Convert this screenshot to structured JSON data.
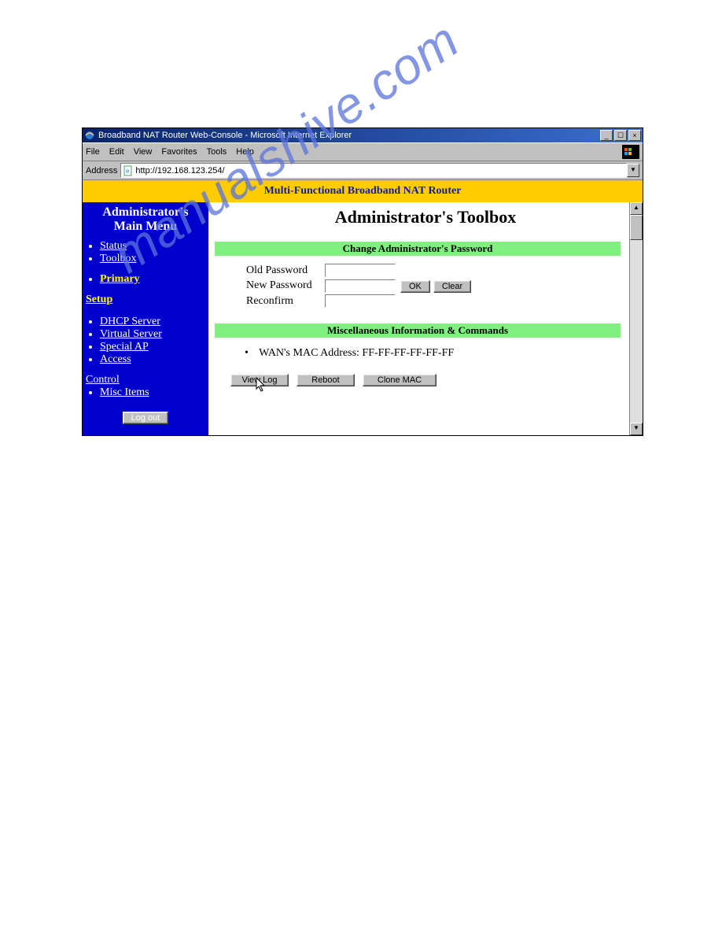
{
  "window": {
    "title": "Broadband NAT Router Web-Console - Microsoft Internet Explorer",
    "min_glyph": "_",
    "max_glyph": "☐",
    "close_glyph": "×"
  },
  "menubar": {
    "items": [
      "File",
      "Edit",
      "View",
      "Favorites",
      "Tools",
      "Help"
    ]
  },
  "addressbar": {
    "label": "Address",
    "value": "http://192.168.123.254/"
  },
  "banner": {
    "text": "Multi-Functional Broadband NAT Router"
  },
  "sidebar": {
    "heading_l1": "Administrator's",
    "heading_l2": "Main Menu",
    "group1": [
      {
        "label": "Status"
      },
      {
        "label": "Toolbox"
      }
    ],
    "primary": {
      "label": "Primary",
      "cont": "Setup"
    },
    "group2": [
      {
        "label": "DHCP Server"
      },
      {
        "label": "Virtual Server"
      },
      {
        "label": "Special AP"
      },
      {
        "label": "Access",
        "cont": "Control"
      },
      {
        "label": "Misc Items"
      }
    ],
    "logout": "Log out"
  },
  "main": {
    "title": "Administrator's Toolbox",
    "pw_section": "Change Administrator's Password",
    "old_pw": "Old Password",
    "new_pw": "New Password",
    "reconfirm": "Reconfirm",
    "ok": "OK",
    "clear": "Clear",
    "misc_section": "Miscellaneous Information & Commands",
    "mac_label": "WAN's MAC Address: ",
    "mac_value": "FF-FF-FF-FF-FF-FF",
    "view_log": "View Log",
    "reboot": "Reboot",
    "clone_mac": "Clone MAC"
  },
  "watermark": "manualshive.com"
}
